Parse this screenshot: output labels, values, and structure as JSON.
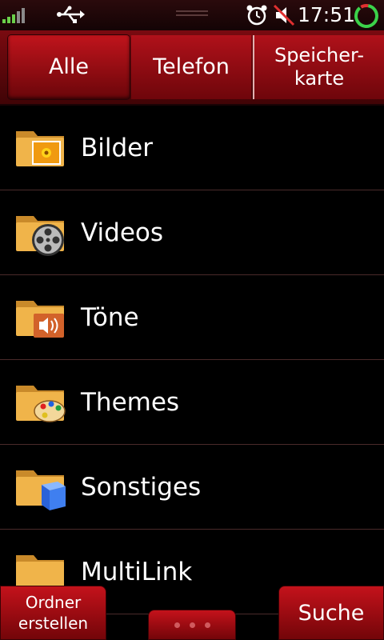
{
  "status": {
    "time": "17:51",
    "icons": [
      "signal-icon",
      "usb-icon",
      "alarm-icon",
      "muted-speaker-icon",
      "battery-ring-icon"
    ],
    "battery_color": "#3bd24a"
  },
  "tabs": [
    {
      "label": "Alle",
      "selected": true
    },
    {
      "label": "Telefon",
      "selected": false
    },
    {
      "label": "Speicher-\nkarte",
      "selected": false
    }
  ],
  "folders": [
    {
      "label": "Bilder",
      "icon": "folder-image-icon"
    },
    {
      "label": "Videos",
      "icon": "folder-film-icon"
    },
    {
      "label": "Töne",
      "icon": "folder-speaker-icon"
    },
    {
      "label": "Themes",
      "icon": "folder-palette-icon"
    },
    {
      "label": "Sonstiges",
      "icon": "folder-cube-icon"
    },
    {
      "label": "MultiLink",
      "icon": "folder-icon"
    }
  ],
  "buttons": {
    "new_folder": "Ordner\nerstellen",
    "search": "Suche"
  },
  "colors": {
    "accent": "#b0111a",
    "folder": "#f0b44a"
  }
}
